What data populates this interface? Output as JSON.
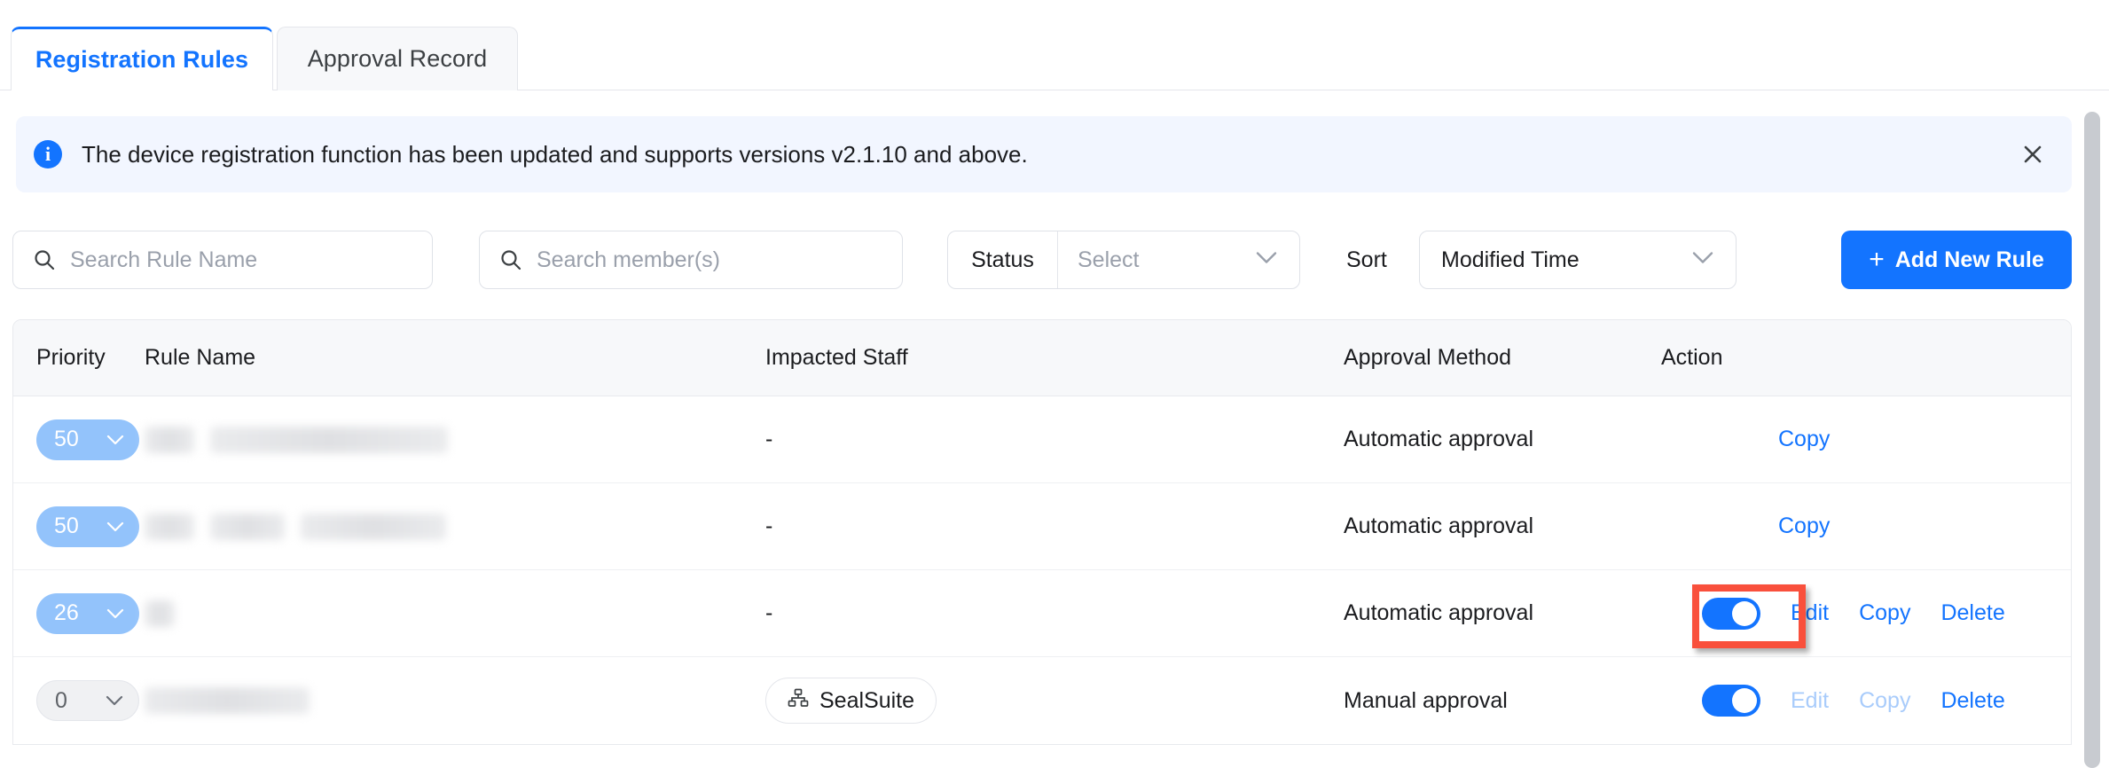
{
  "tabs": [
    {
      "label": "Registration Rules",
      "active": true
    },
    {
      "label": "Approval Record",
      "active": false
    }
  ],
  "banner": {
    "icon": "info-icon",
    "message": "The device registration function has been updated and supports versions v2.1.10 and above.",
    "close_icon": "close-icon",
    "background": "#f2f6ff",
    "accent": "#1374ff"
  },
  "toolbar": {
    "search_rule": {
      "placeholder": "Search Rule Name",
      "value": "",
      "icon": "search-icon"
    },
    "search_member": {
      "placeholder": "Search member(s)",
      "value": "",
      "icon": "search-icon"
    },
    "status": {
      "label": "Status",
      "value": "",
      "placeholder": "Select",
      "icon": "chevron-down-icon"
    },
    "sort": {
      "label": "Sort",
      "value": "Modified Time",
      "icon": "chevron-down-icon"
    },
    "add_button": {
      "label": "Add New Rule",
      "icon": "plus-icon",
      "color": "#1374ff"
    }
  },
  "table": {
    "columns": [
      "Priority",
      "Rule Name",
      "Impacted Staff",
      "Approval Method",
      "Action"
    ],
    "rows": [
      {
        "priority": "50",
        "priority_state": "active",
        "rule_name": "",
        "rule_name_redacted": true,
        "impacted_staff": "-",
        "approval_method": "Automatic approval",
        "toggle": null,
        "actions": [
          {
            "label": "Copy",
            "enabled": true
          }
        ]
      },
      {
        "priority": "50",
        "priority_state": "active",
        "rule_name": "",
        "rule_name_redacted": true,
        "impacted_staff": "-",
        "approval_method": "Automatic approval",
        "toggle": null,
        "actions": [
          {
            "label": "Copy",
            "enabled": true
          }
        ]
      },
      {
        "priority": "26",
        "priority_state": "active",
        "rule_name": "",
        "rule_name_redacted": true,
        "impacted_staff": "-",
        "approval_method": "Automatic approval",
        "toggle": "on",
        "highlighted": true,
        "actions": [
          {
            "label": "Edit",
            "enabled": true
          },
          {
            "label": "Copy",
            "enabled": true
          },
          {
            "label": "Delete",
            "enabled": true
          }
        ]
      },
      {
        "priority": "0",
        "priority_state": "disabled",
        "rule_name": "",
        "rule_name_redacted": true,
        "impacted_staff": "SealSuite",
        "impacted_staff_icon": "org-chart-icon",
        "approval_method": "Manual approval",
        "toggle": "on",
        "actions": [
          {
            "label": "Edit",
            "enabled": false
          },
          {
            "label": "Copy",
            "enabled": false
          },
          {
            "label": "Delete",
            "enabled": true
          }
        ]
      }
    ]
  },
  "highlight": {
    "color": "#f9503c",
    "target": "row-3-status-toggle"
  },
  "scrollbar": {
    "color": "#c8cbd0"
  }
}
